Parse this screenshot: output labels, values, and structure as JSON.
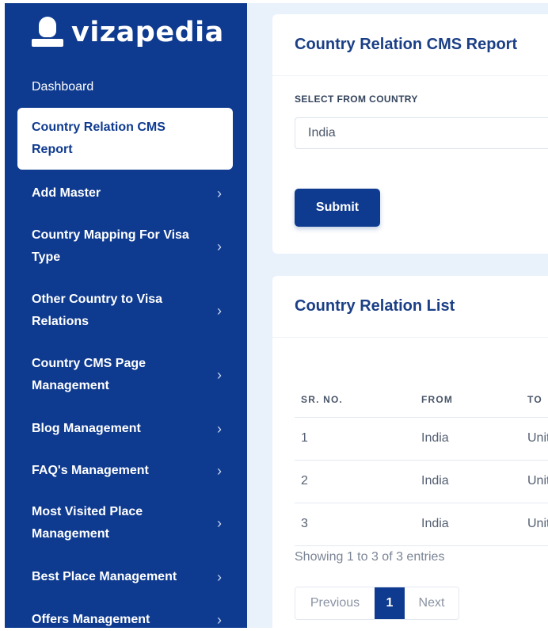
{
  "brand": {
    "name": "vizapedia",
    "icon": "user-icon"
  },
  "sidebar": {
    "items": [
      {
        "label": "Dashboard",
        "chevron": ""
      },
      {
        "label": "Country Relation CMS Report",
        "chevron": ""
      },
      {
        "label": "Add Master",
        "chevron": "›"
      },
      {
        "label": "Country Mapping For Visa Type",
        "chevron": "›"
      },
      {
        "label": "Other Country to Visa Relations",
        "chevron": "›"
      },
      {
        "label": "Country CMS Page Management",
        "chevron": "›"
      },
      {
        "label": "Blog Management",
        "chevron": "›"
      },
      {
        "label": "FAQ's Management",
        "chevron": "›"
      },
      {
        "label": "Most Visited Place Management",
        "chevron": "›"
      },
      {
        "label": "Best Place Management",
        "chevron": "›"
      },
      {
        "label": "Offers Management",
        "chevron": "›"
      }
    ]
  },
  "report": {
    "title": "Country Relation CMS Report",
    "field_label": "SELECT FROM COUNTRY",
    "selected": "India",
    "submit_label": "Submit"
  },
  "list": {
    "title": "Country Relation List",
    "columns": [
      "SR. NO.",
      "FROM",
      "TO"
    ],
    "rows": [
      [
        "1",
        "India",
        "Unit"
      ],
      [
        "2",
        "India",
        "Unit"
      ],
      [
        "3",
        "India",
        "Unit"
      ]
    ],
    "info": "Showing 1 to 3 of 3 entries",
    "pagination": {
      "prev": "Previous",
      "page": "1",
      "next": "Next"
    }
  },
  "colors": {
    "primary": "#0e3a8f",
    "background": "#e9f1fb",
    "title": "#1b3f86"
  }
}
